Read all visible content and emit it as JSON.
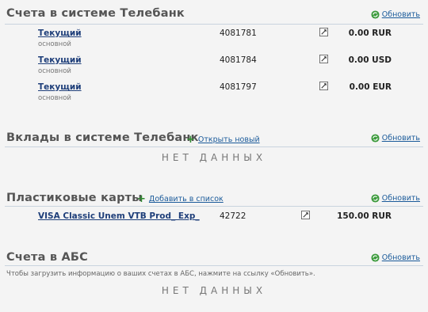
{
  "refresh_label": "Обновить",
  "sections": {
    "tb_accounts": {
      "title": "Счета в системе Телебанк"
    },
    "deposits": {
      "title": "Вклады в системе Телебанк",
      "add_label": "Открыть новый",
      "empty": "НЕТ ДАННЫХ"
    },
    "cards": {
      "title": "Пластиковые карты",
      "add_label": "Добавить в список"
    },
    "abs": {
      "title": "Счета в АБС",
      "hint": "Чтобы загрузить информацию о ваших счетах в АБС, нажмите на ссылку «Обновить».",
      "empty": "НЕТ ДАННЫХ"
    }
  },
  "accounts": [
    {
      "name": "Текущий",
      "subtitle": "основной",
      "number": "4081781",
      "amount": "0.00 RUR"
    },
    {
      "name": "Текущий",
      "subtitle": "основной",
      "number": "4081784",
      "amount": "0.00 USD"
    },
    {
      "name": "Текущий",
      "subtitle": "основной",
      "number": "4081797",
      "amount": "0.00 EUR"
    }
  ],
  "card": {
    "name": "VISA Classic Unem VTB Prod_    Exp_",
    "number": "42722",
    "amount": "150.00 RUR"
  },
  "colors": {
    "link": "#1a5a9a",
    "title": "#555555",
    "refresh_icon": "#2f8a2f",
    "divider": "#c9d3de"
  }
}
